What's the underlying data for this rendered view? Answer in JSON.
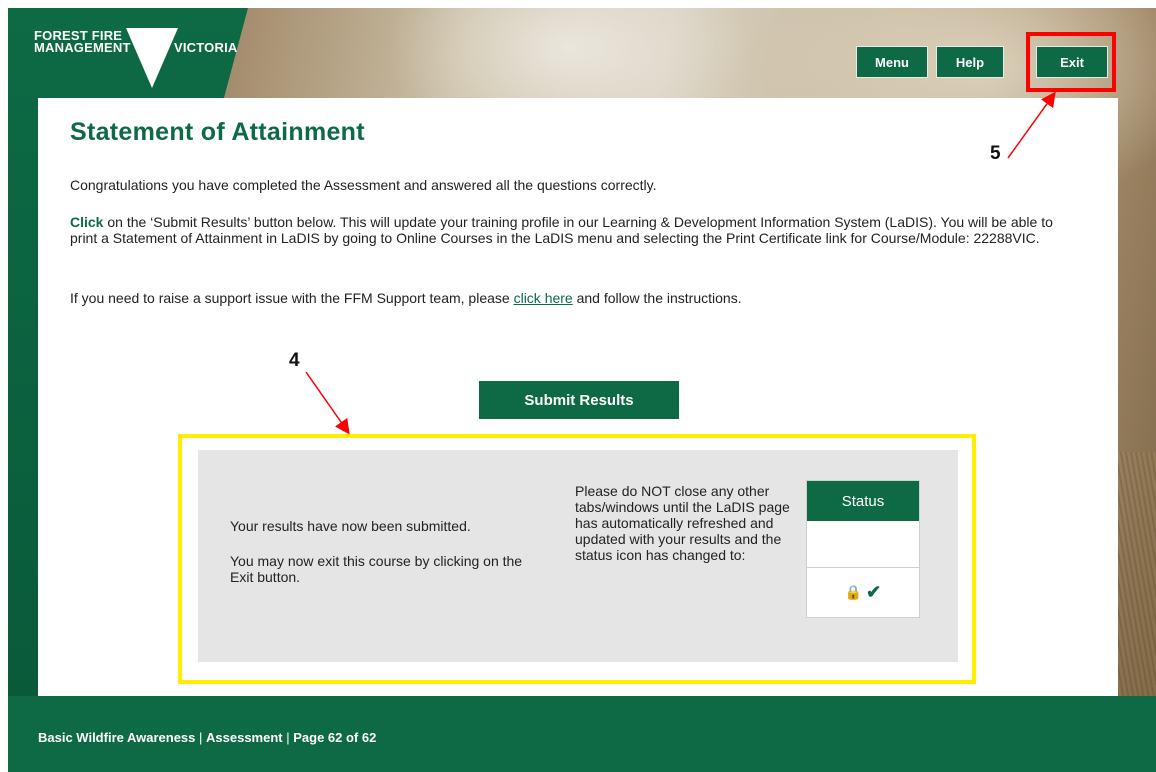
{
  "header": {
    "logo_line1": "FOREST FIRE",
    "logo_line2": "MANAGEMENT",
    "logo_line3": "VICTORIA",
    "nav": {
      "menu": "Menu",
      "help": "Help",
      "exit": "Exit"
    }
  },
  "annotations": {
    "label_4": "4",
    "label_5": "5"
  },
  "main": {
    "title": "Statement of Attainment",
    "para1": "Congratulations you have completed the Assessment and answered all the questions correctly.",
    "para2_click": "Click",
    "para2_rest": " on the ‘Submit Results’ button below. This will update your training profile in our Learning & Development Information System (LaDIS). You will be able to print a Statement of Attainment in LaDIS by going to Online Courses in the LaDIS menu and selecting the Print Certificate link for Course/Module: 22288VIC.",
    "para3_before": "If you need to raise a support issue with the FFM Support team, please ",
    "para3_link": "click here",
    "para3_after": " and follow the instructions.",
    "submit_label": "Submit Results"
  },
  "result_box": {
    "submitted_text": "Your results have now been submitted.",
    "exit_text": "You may now exit this course by clicking on the Exit button.",
    "warning_text": "Please do NOT close any other tabs/windows until the LaDIS page has automatically refreshed and updated with your results and the status icon has changed to:",
    "status_header": "Status",
    "status_icons": [
      "lock-icon",
      "check-icon"
    ]
  },
  "footer": {
    "course": "Basic Wildfire Awareness",
    "section": "Assessment",
    "page": "Page 62 of 62",
    "separator": " | "
  },
  "colors": {
    "brand_green": "#0d6a45",
    "highlight_red": "#ff0000",
    "highlight_yellow": "#ffee00"
  }
}
